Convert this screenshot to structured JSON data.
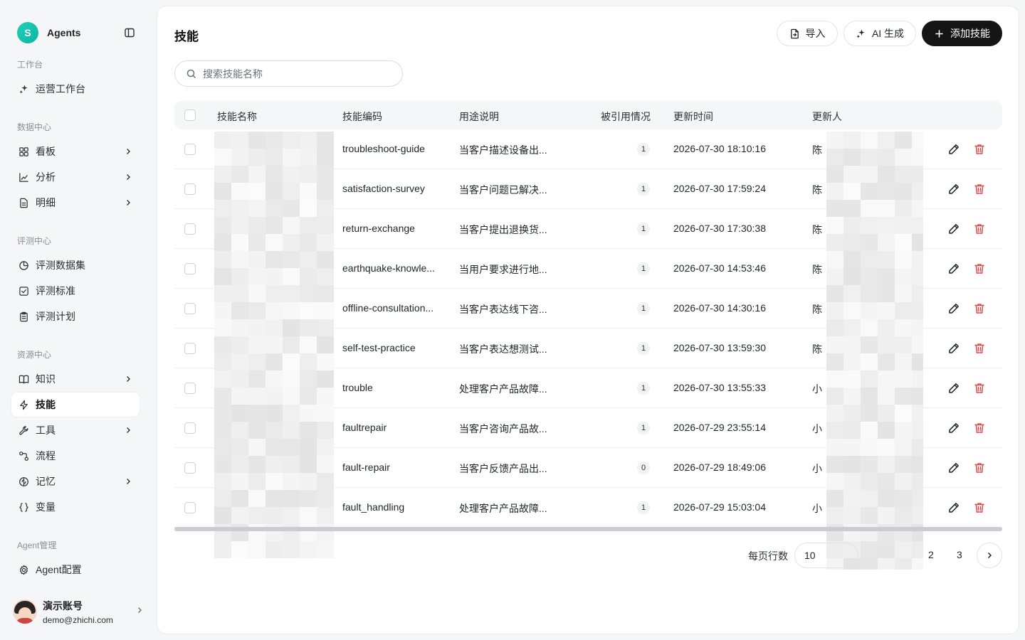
{
  "brand": {
    "logo_letter": "S",
    "name": "Agents"
  },
  "sidebar": {
    "groups": [
      {
        "title": "工作台",
        "items": [
          {
            "label": "运营工作台",
            "icon": "sparkle-icon",
            "has_children": false
          }
        ]
      },
      {
        "title": "数据中心",
        "items": [
          {
            "label": "看板",
            "icon": "dashboard-icon",
            "has_children": true
          },
          {
            "label": "分析",
            "icon": "line-chart-icon",
            "has_children": true
          },
          {
            "label": "明细",
            "icon": "document-icon",
            "has_children": true
          }
        ]
      },
      {
        "title": "评测中心",
        "items": [
          {
            "label": "评测数据集",
            "icon": "pie-chart-icon",
            "has_children": false
          },
          {
            "label": "评测标准",
            "icon": "checkbox-icon",
            "has_children": false
          },
          {
            "label": "评测计划",
            "icon": "clipboard-icon",
            "has_children": false
          }
        ]
      },
      {
        "title": "资源中心",
        "items": [
          {
            "label": "知识",
            "icon": "book-icon",
            "has_children": true
          },
          {
            "label": "技能",
            "icon": "bolt-icon",
            "has_children": false,
            "active": true
          },
          {
            "label": "工具",
            "icon": "wrench-icon",
            "has_children": true
          },
          {
            "label": "流程",
            "icon": "flow-icon",
            "has_children": false
          },
          {
            "label": "记忆",
            "icon": "brain-icon",
            "has_children": true
          },
          {
            "label": "变量",
            "icon": "braces-icon",
            "has_children": false
          }
        ]
      },
      {
        "title": "Agent管理",
        "items": [
          {
            "label": "Agent配置",
            "icon": "gear-icon",
            "has_children": false
          }
        ]
      }
    ]
  },
  "user": {
    "name": "演示账号",
    "email": "demo@zhichi.com"
  },
  "page": {
    "title": "技能",
    "import_label": "导入",
    "ai_label": "AI 生成",
    "add_label": "添加技能",
    "search_placeholder": "搜索技能名称"
  },
  "table": {
    "columns": [
      "技能名称",
      "技能编码",
      "用途说明",
      "被引用情况",
      "更新时间",
      "更新人"
    ],
    "rows": [
      {
        "code": "troubleshoot-guide",
        "desc": "当客户描述设备出...",
        "refs": "1",
        "time": "2026-07-30 18:10:16",
        "user": "陈"
      },
      {
        "code": "satisfaction-survey",
        "desc": "当客户问题已解决...",
        "refs": "1",
        "time": "2026-07-30 17:59:24",
        "user": "陈"
      },
      {
        "code": "return-exchange",
        "desc": "当客户提出退换货...",
        "refs": "1",
        "time": "2026-07-30 17:30:38",
        "user": "陈"
      },
      {
        "code": "earthquake-knowle...",
        "desc": "当用户要求进行地...",
        "refs": "1",
        "time": "2026-07-30 14:53:46",
        "user": "陈"
      },
      {
        "code": "offline-consultation...",
        "desc": "当客户表达线下咨...",
        "refs": "1",
        "time": "2026-07-30 14:30:16",
        "user": "陈"
      },
      {
        "code": "self-test-practice",
        "desc": "当客户表达想测试...",
        "refs": "1",
        "time": "2026-07-30 13:59:30",
        "user": "陈"
      },
      {
        "code": "trouble",
        "desc": "处理客户产品故障...",
        "refs": "1",
        "time": "2026-07-30 13:55:33",
        "user": "小"
      },
      {
        "code": "faultrepair",
        "desc": "当客户咨询产品故...",
        "refs": "1",
        "time": "2026-07-29 23:55:14",
        "user": "小"
      },
      {
        "code": "fault-repair",
        "desc": "当客户反馈产品出...",
        "refs": "0",
        "time": "2026-07-29 18:49:06",
        "user": "小"
      },
      {
        "code": "fault_handling",
        "desc": "处理客户产品故障...",
        "refs": "1",
        "time": "2026-07-29 15:03:04",
        "user": "小"
      }
    ]
  },
  "pagination": {
    "rows_label": "每页行数",
    "page_size": "10",
    "pages": [
      "2",
      "3"
    ]
  },
  "colors": {
    "accent": "#151515",
    "delete": "#e5484d",
    "brand": "#10b3a0"
  }
}
